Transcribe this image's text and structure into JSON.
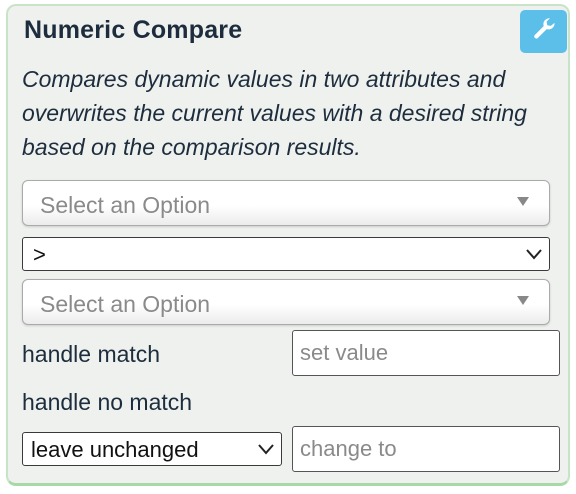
{
  "panel": {
    "title": "Numeric Compare",
    "settings_icon": "wrench-icon",
    "description": "Compares dynamic values in two attributes and overwrites the current values with a desired string based on the comparison results.",
    "accent_color": "#5bbfea",
    "border_color": "#a8d8a5"
  },
  "attribute_a": {
    "placeholder": "Select an Option"
  },
  "operator": {
    "selected": ">"
  },
  "attribute_b": {
    "placeholder": "Select an Option"
  },
  "match": {
    "label": "handle match",
    "input_placeholder": "set value"
  },
  "no_match": {
    "label": "handle no match",
    "action_selected": "leave unchanged",
    "input_placeholder": "change to"
  }
}
